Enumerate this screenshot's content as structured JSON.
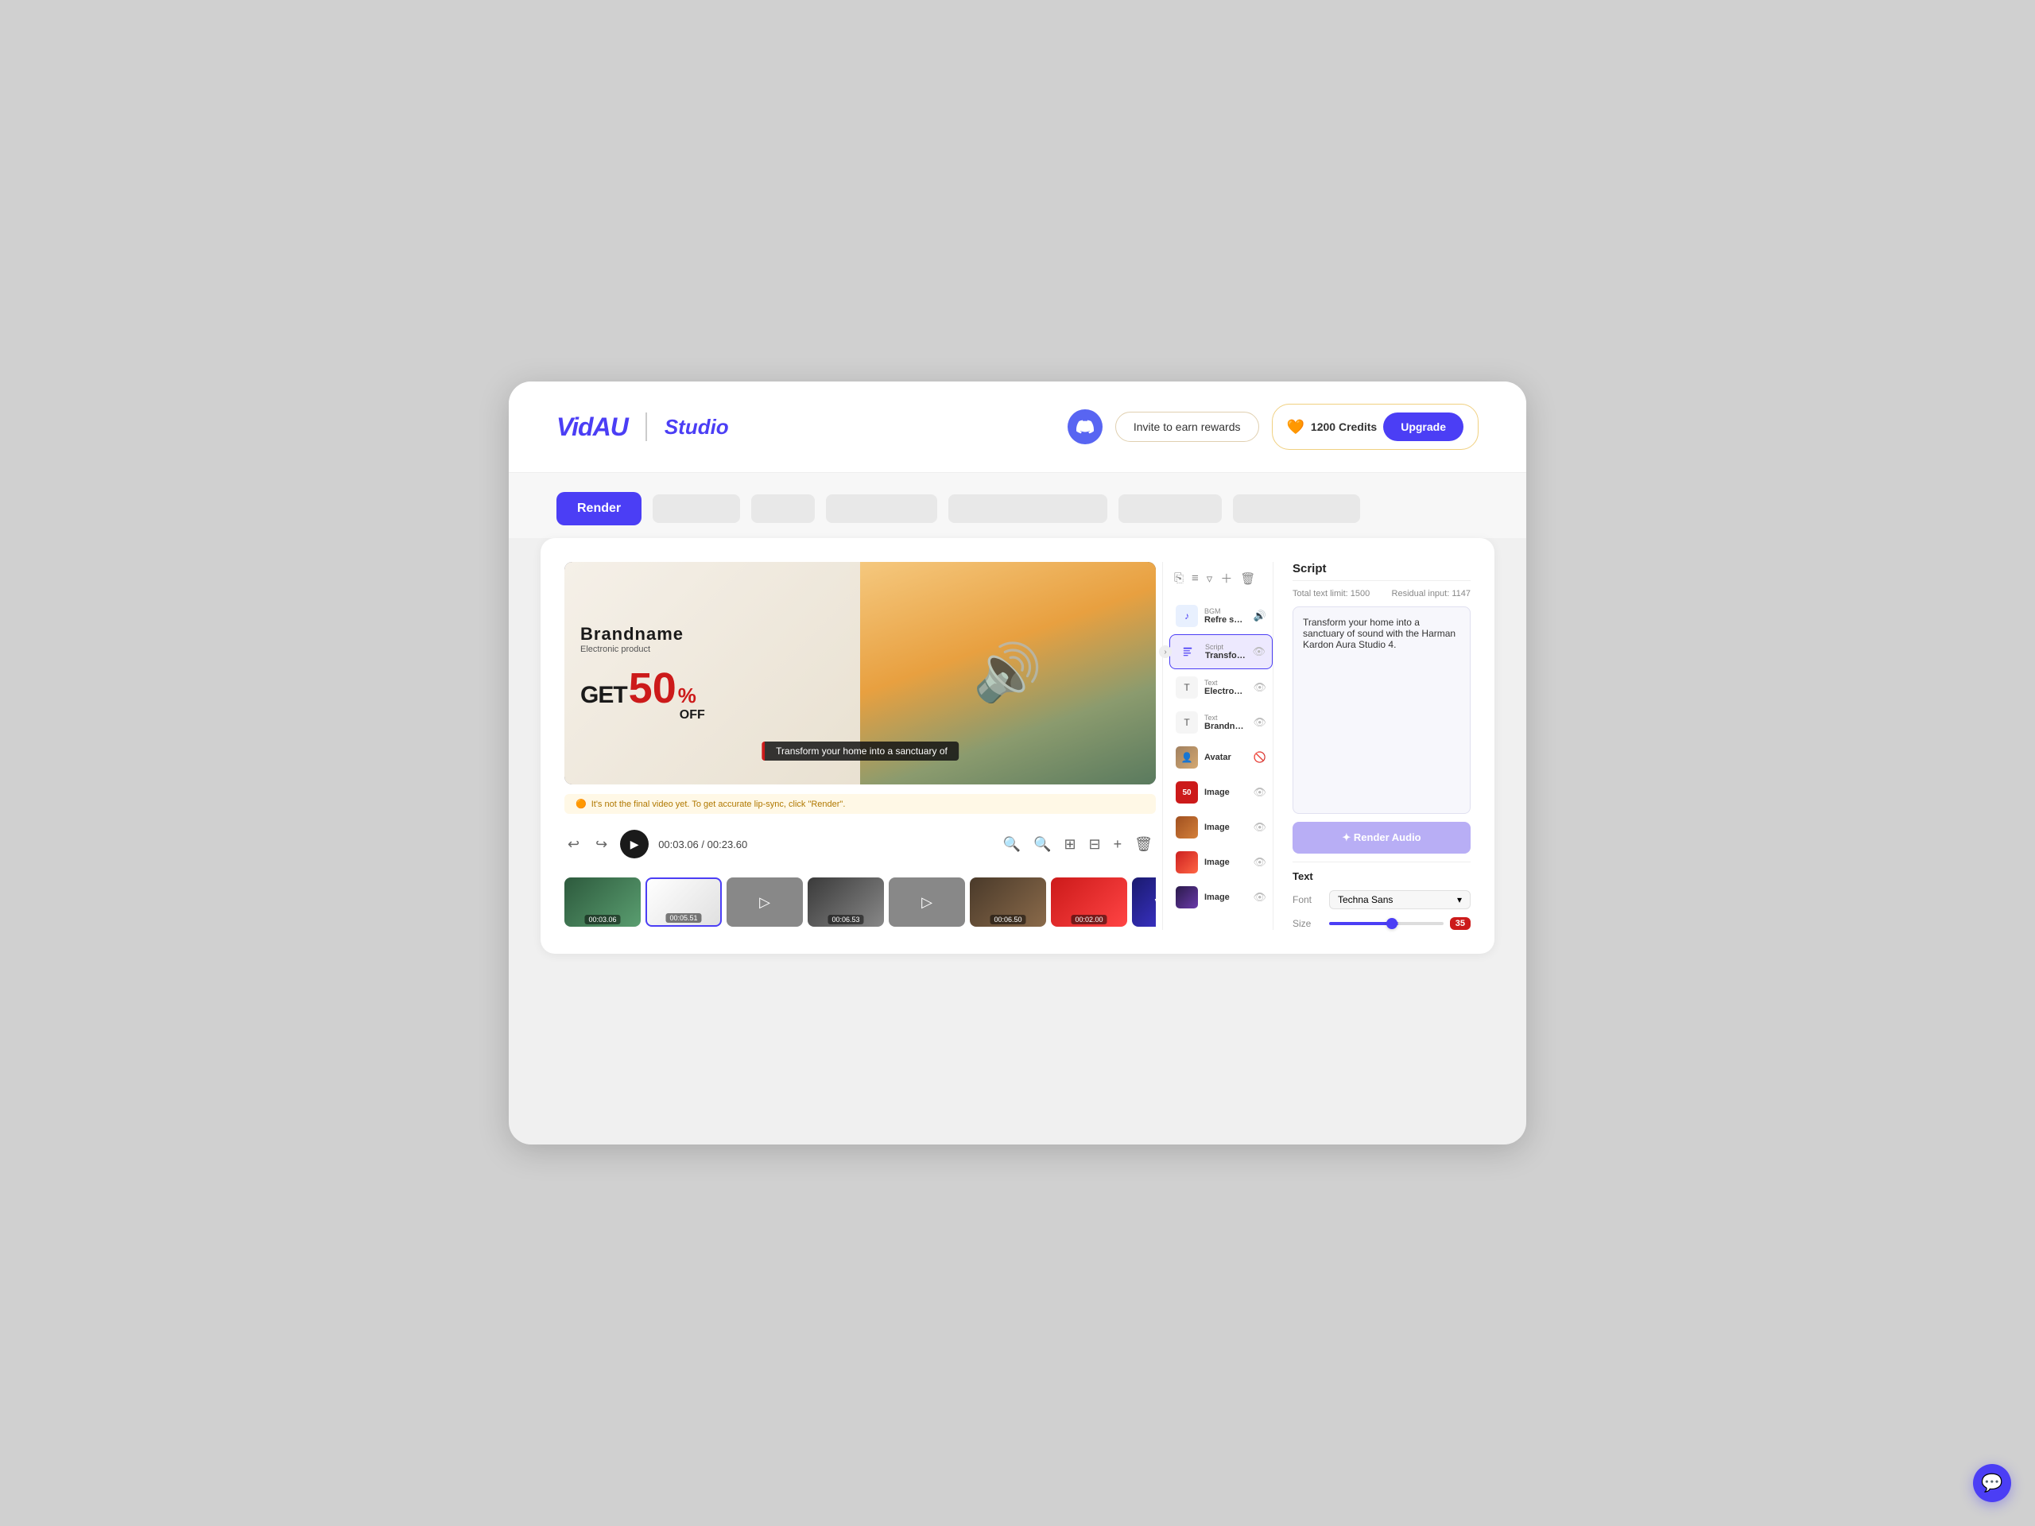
{
  "app": {
    "logo": "VidAU",
    "studio": "Studio"
  },
  "header": {
    "discord_label": "discord",
    "invite_label": "Invite to earn rewards",
    "credits_label": "1200 Credits",
    "upgrade_label": "Upgrade"
  },
  "toolbar": {
    "render_label": "Render",
    "tabs": [
      "",
      "",
      "",
      "",
      "",
      ""
    ]
  },
  "video": {
    "brand_name": "Brandname",
    "product_subtitle": "Electronic product",
    "get_text": "GET",
    "discount_number": "50",
    "percent_sign": "%",
    "off_text": "OFF",
    "caption_text": "Transform your home into a sanctuary of",
    "warning_text": "It's not the final video yet. To get accurate lip-sync, click \"Render\".",
    "warning_icon": "⚠",
    "time_current": "00:03.06",
    "time_total": "00:23.60"
  },
  "timeline": {
    "thumbs": [
      {
        "time": "00:03.06",
        "active": false
      },
      {
        "time": "00:05.51",
        "active": true
      },
      {
        "time": "00:06.53",
        "active": false
      },
      {
        "time": "00:06.50",
        "active": false
      },
      {
        "time": "00:02.00",
        "active": false
      }
    ]
  },
  "layers": {
    "toolbar_icons": [
      "copy",
      "align",
      "filter",
      "add",
      "delete"
    ],
    "items": [
      {
        "type": "BGM",
        "name": "Refre shing S...",
        "icon": "♪",
        "eye": true
      },
      {
        "type": "Script",
        "name": "Transform yo...",
        "active": true,
        "eye": true
      },
      {
        "type": "Text",
        "name": "Electronic pro...",
        "eye": true
      },
      {
        "type": "Text",
        "name": "Brandname",
        "eye": true
      },
      {
        "type": "Avatar",
        "name": "Avatar",
        "eye": false
      },
      {
        "type": "",
        "name": "Image",
        "label": "50",
        "eye": true
      },
      {
        "type": "",
        "name": "Image",
        "eye": true
      },
      {
        "type": "",
        "name": "Image",
        "eye": true
      },
      {
        "type": "",
        "name": "Image",
        "eye": true
      }
    ]
  },
  "script": {
    "title": "Script",
    "total_limit_label": "Total text limit: 1500",
    "residual_label": "Residual input: 1147",
    "content": "Transform your home into a sanctuary of sound with the Harman Kardon Aura Studio 4.",
    "render_audio_label": "✦ Render Audio"
  },
  "text_settings": {
    "title": "Text",
    "font_label": "Font",
    "font_value": "Techna Sans",
    "size_label": "Size",
    "size_value": "35"
  }
}
